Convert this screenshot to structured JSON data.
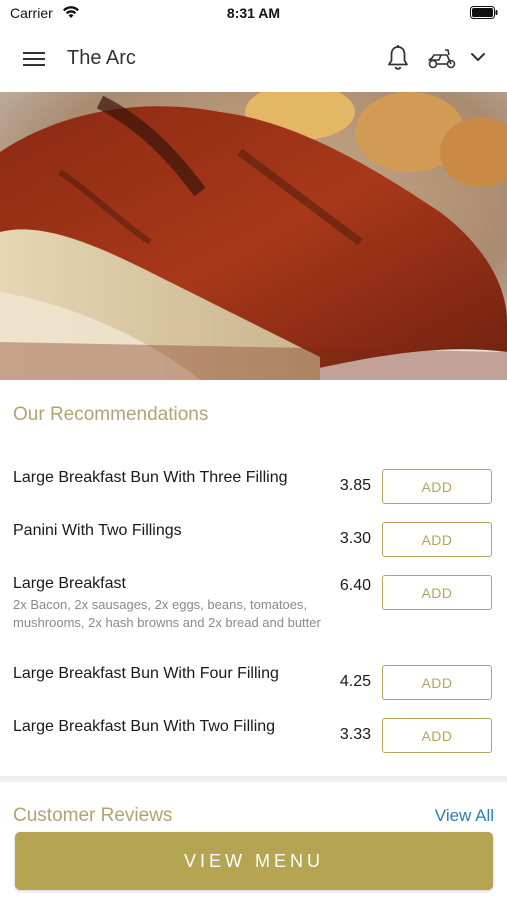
{
  "status_bar": {
    "carrier": "Carrier",
    "time": "8:31 AM"
  },
  "header": {
    "title": "The Arc",
    "icons": [
      "menu-icon",
      "bell-icon",
      "scooter-icon",
      "chevron-down-icon"
    ]
  },
  "recommendations": {
    "title": "Our Recommendations",
    "add_label": "ADD",
    "items": [
      {
        "name": "Large Breakfast Bun With Three Filling",
        "price": "3.85",
        "description": ""
      },
      {
        "name": "Panini With Two Fillings",
        "price": "3.30",
        "description": ""
      },
      {
        "name": "Large Breakfast",
        "price": "6.40",
        "description": "2x Bacon, 2x sausages, 2x eggs, beans, tomatoes, mushrooms, 2x hash browns and 2x bread and butter"
      },
      {
        "name": "Large Breakfast Bun With Four Filling",
        "price": "4.25",
        "description": ""
      },
      {
        "name": "Large Breakfast Bun With Two Filling",
        "price": "3.33",
        "description": ""
      }
    ]
  },
  "reviews": {
    "title": "Customer Reviews",
    "view_all": "View All"
  },
  "footer": {
    "view_menu": "VIEW MENU"
  },
  "colors": {
    "accent_gold": "#b5a552",
    "section_title": "#b5a274",
    "link_blue": "#2a7fb8"
  }
}
